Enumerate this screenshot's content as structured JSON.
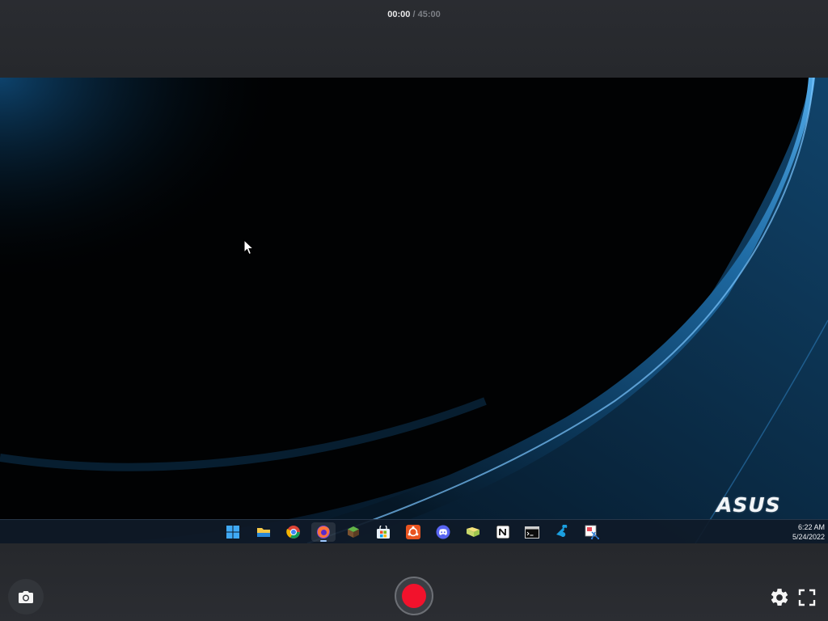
{
  "timer": {
    "current": "00:00",
    "separator": " / ",
    "total": "45:00"
  },
  "desktop": {
    "logo_text": "ASUS",
    "clock": {
      "time": "6:22 AM",
      "date": "5/24/2022"
    },
    "taskbar_icons": [
      {
        "name": "start-icon"
      },
      {
        "name": "file-explorer-icon"
      },
      {
        "name": "chrome-icon"
      },
      {
        "name": "firefox-icon",
        "active": true
      },
      {
        "name": "minecraft-icon"
      },
      {
        "name": "microsoft-store-icon"
      },
      {
        "name": "ubuntu-icon"
      },
      {
        "name": "discord-icon"
      },
      {
        "name": "folder-icon"
      },
      {
        "name": "notion-icon"
      },
      {
        "name": "terminal-icon"
      },
      {
        "name": "steam-icon"
      },
      {
        "name": "snipping-tool-icon"
      }
    ]
  },
  "colors": {
    "record": "#f2122c",
    "bar_background": "#26282c",
    "wallpaper_accent": "#2a8bd0",
    "taskbar": "#0f1a28"
  }
}
